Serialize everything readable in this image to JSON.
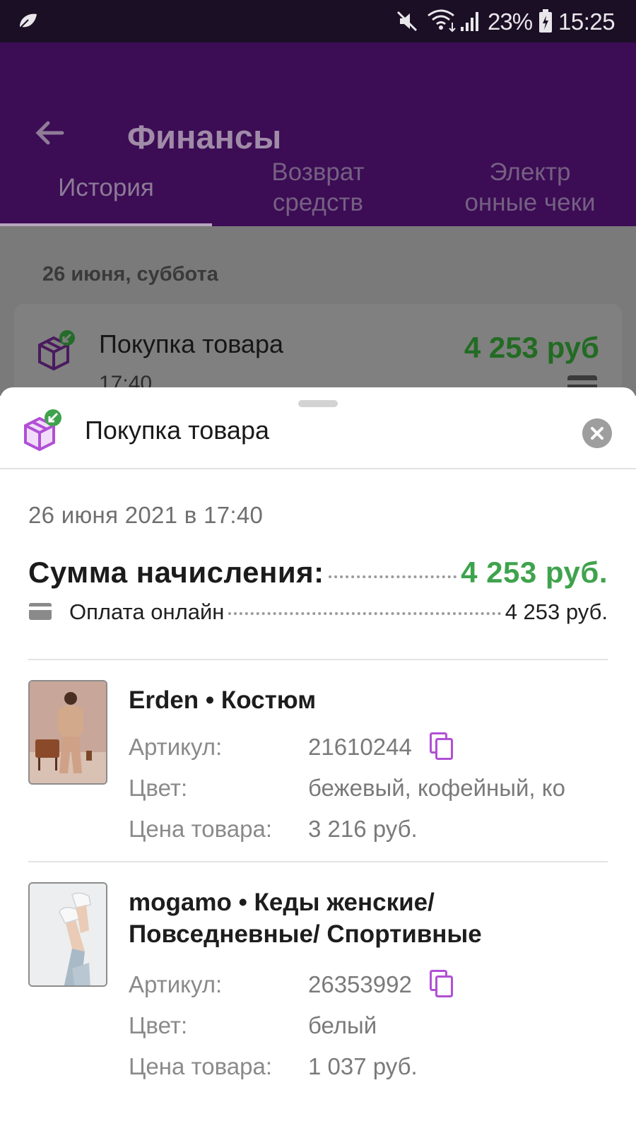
{
  "status_bar": {
    "battery": "23%",
    "time": "15:25"
  },
  "app_bar": {
    "title": "Финансы"
  },
  "tabs": [
    {
      "line1": "История",
      "line2": ""
    },
    {
      "line1": "Возврат",
      "line2": "средств"
    },
    {
      "line1": "Электр",
      "line2": "онные чеки"
    }
  ],
  "history": {
    "date_header": "26 июня, суббота",
    "item": {
      "title": "Покупка товара",
      "time": "17:40",
      "amount": "4 253 руб"
    }
  },
  "sheet": {
    "title": "Покупка товара",
    "datetime": "26 июня 2021 в 17:40",
    "sum_label": "Сумма начисления:",
    "sum_value": "4 253 руб.",
    "payment_label": "Оплата онлайн",
    "payment_value": "4 253 руб.",
    "labels": {
      "article": "Артикул:",
      "color": "Цвет:",
      "price": "Цена товара:"
    },
    "products": [
      {
        "name": "Erden • Костюм",
        "article": "21610244",
        "color": "бежевый, кофейный, ко",
        "price": "3 216 руб."
      },
      {
        "name": "mogamo • Кеды женские/ Повседневные/ Спортивные",
        "article": "26353992",
        "color": "белый",
        "price": "1 037 руб."
      }
    ]
  },
  "colors": {
    "brand": "#3c0c55",
    "accent_green": "#3fa34d",
    "icon_purple": "#b14fd6"
  },
  "icons": [
    "leaf-icon",
    "mute-icon",
    "wifi-icon",
    "signal-icon",
    "battery-icon",
    "back-arrow-icon",
    "package-return-icon",
    "card-icon",
    "close-icon",
    "copy-icon"
  ]
}
